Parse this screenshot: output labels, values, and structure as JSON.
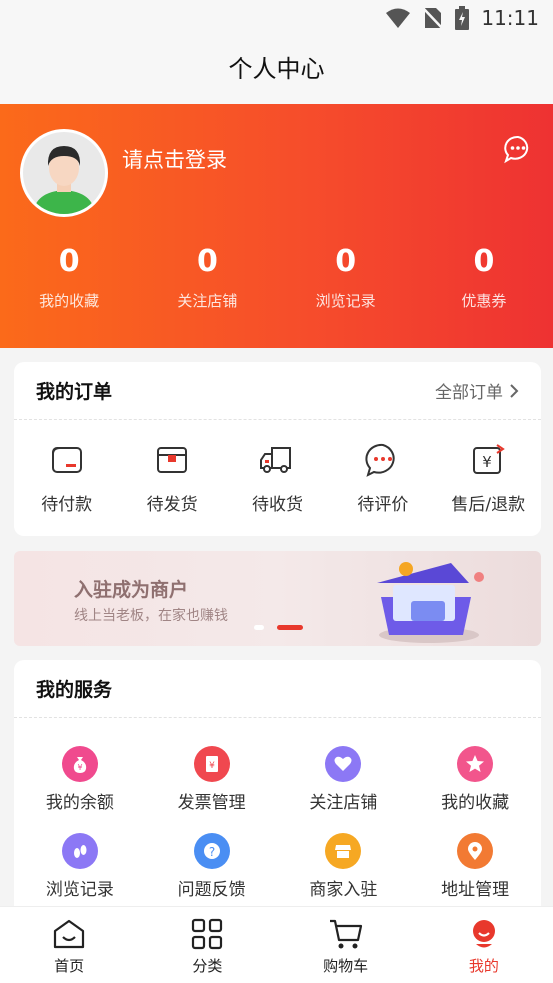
{
  "status_bar": {
    "time": "11:11"
  },
  "header": {
    "title": "个人中心"
  },
  "profile": {
    "login_prompt": "请点击登录"
  },
  "stats": [
    {
      "value": "0",
      "label": "我的收藏"
    },
    {
      "value": "0",
      "label": "关注店铺"
    },
    {
      "value": "0",
      "label": "浏览记录"
    },
    {
      "value": "0",
      "label": "优惠券"
    }
  ],
  "orders": {
    "title": "我的订单",
    "more": "全部订单",
    "items": [
      {
        "label": "待付款",
        "icon": "wallet-icon"
      },
      {
        "label": "待发货",
        "icon": "package-icon"
      },
      {
        "label": "待收货",
        "icon": "truck-icon"
      },
      {
        "label": "待评价",
        "icon": "comment-icon"
      },
      {
        "label": "售后/退款",
        "icon": "refund-icon"
      }
    ]
  },
  "banner": {
    "title": "入驻成为商户",
    "subtitle": "线上当老板，在家也赚钱"
  },
  "services": {
    "title": "我的服务",
    "items": [
      {
        "label": "我的余额",
        "icon": "money-bag-icon",
        "color": "#f04a8e"
      },
      {
        "label": "发票管理",
        "icon": "invoice-icon",
        "color": "#f0484f"
      },
      {
        "label": "关注店铺",
        "icon": "heart-icon",
        "color": "#8c78f5"
      },
      {
        "label": "我的收藏",
        "icon": "star-icon",
        "color": "#f2558c"
      },
      {
        "label": "浏览记录",
        "icon": "footprint-icon",
        "color": "#8c78f5"
      },
      {
        "label": "问题反馈",
        "icon": "question-icon",
        "color": "#4a8ef3"
      },
      {
        "label": "商家入驻",
        "icon": "store-icon",
        "color": "#f6a823"
      },
      {
        "label": "地址管理",
        "icon": "location-icon",
        "color": "#f27a33"
      }
    ]
  },
  "tabbar": [
    {
      "label": "首页",
      "icon": "home-icon"
    },
    {
      "label": "分类",
      "icon": "category-icon"
    },
    {
      "label": "购物车",
      "icon": "cart-icon"
    },
    {
      "label": "我的",
      "icon": "profile-icon",
      "active": true
    }
  ],
  "colors": {
    "accent": "#e8382c",
    "hero_start": "#fb6a1a",
    "hero_end": "#ee3232"
  }
}
